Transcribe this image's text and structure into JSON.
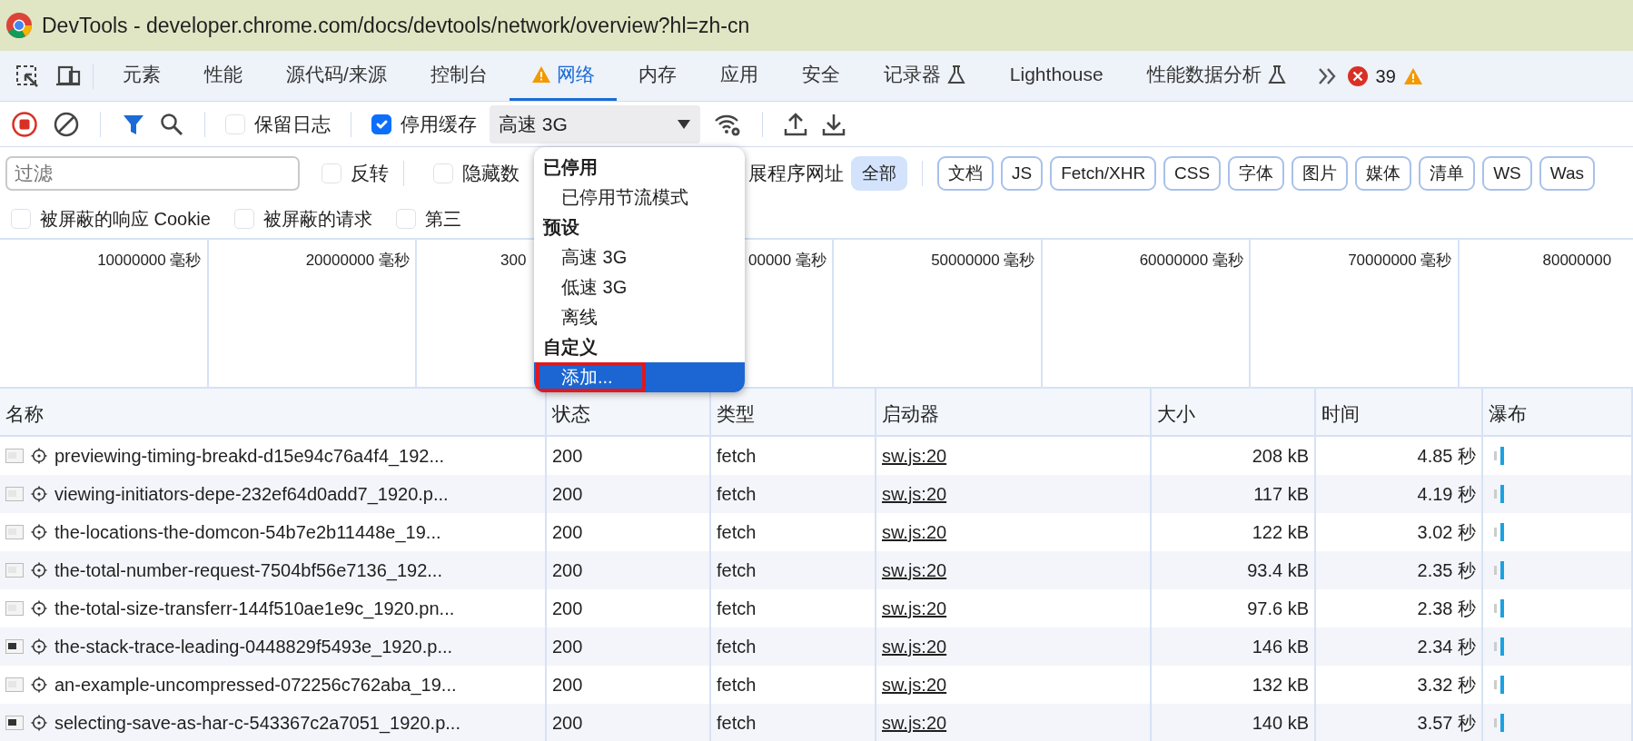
{
  "window": {
    "title": "DevTools - developer.chrome.com/docs/devtools/network/overview?hl=zh-cn"
  },
  "panel_tabs": [
    {
      "label": "元素",
      "selected": false
    },
    {
      "label": "性能",
      "selected": false
    },
    {
      "label": "源代码/来源",
      "selected": false
    },
    {
      "label": "控制台",
      "selected": false
    },
    {
      "label": "网络",
      "selected": true,
      "warning": true
    },
    {
      "label": "内存",
      "selected": false
    },
    {
      "label": "应用",
      "selected": false
    },
    {
      "label": "安全",
      "selected": false
    },
    {
      "label": "记录器",
      "selected": false,
      "experimental": true
    },
    {
      "label": "Lighthouse",
      "selected": false
    },
    {
      "label": "性能数据分析",
      "selected": false,
      "experimental": true
    }
  ],
  "issues": {
    "errors": "39"
  },
  "toolbar": {
    "recording": true,
    "filter_active": true,
    "preserve_log": {
      "label": "保留日志",
      "checked": false
    },
    "disable_cache": {
      "label": "停用缓存",
      "checked": true
    },
    "throttling": {
      "value": "高速 3G"
    }
  },
  "filter_bar": {
    "placeholder": "过滤",
    "options": [
      {
        "label": "反转",
        "checked": false
      },
      {
        "label": "隐藏数",
        "checked": false
      }
    ],
    "hidden_option_tail": "展程序网址",
    "type_filters": [
      {
        "label": "全部",
        "selected": true
      },
      {
        "label": "文档",
        "selected": false
      },
      {
        "label": "JS",
        "selected": false
      },
      {
        "label": "Fetch/XHR",
        "selected": false
      },
      {
        "label": "CSS",
        "selected": false
      },
      {
        "label": "字体",
        "selected": false
      },
      {
        "label": "图片",
        "selected": false
      },
      {
        "label": "媒体",
        "selected": false
      },
      {
        "label": "清单",
        "selected": false
      },
      {
        "label": "WS",
        "selected": false
      },
      {
        "label": "Was",
        "selected": false
      }
    ]
  },
  "blocked_filters": [
    {
      "label": "被屏蔽的响应 Cookie",
      "checked": false
    },
    {
      "label": "被屏蔽的请求",
      "checked": false
    },
    {
      "label": "第三",
      "checked": false
    }
  ],
  "overview": {
    "ticks": [
      {
        "label": "10000000 毫秒",
        "kind": "full"
      },
      {
        "label": "20000000 毫秒",
        "kind": "full"
      },
      {
        "label": "300",
        "kind": "cut"
      },
      {
        "label": "00000 毫秒",
        "kind": "full"
      },
      {
        "label": "50000000 毫秒",
        "kind": "full"
      },
      {
        "label": "60000000 毫秒",
        "kind": "full"
      },
      {
        "label": "70000000 毫秒",
        "kind": "full"
      },
      {
        "label": "80000000",
        "kind": "cut"
      }
    ]
  },
  "throttling_menu": {
    "groups": [
      {
        "heading": "已停用",
        "options": [
          {
            "label": "已停用节流模式",
            "selected": false,
            "outlined": false
          }
        ]
      },
      {
        "heading": "预设",
        "options": [
          {
            "label": "高速 3G",
            "selected": false,
            "outlined": false
          },
          {
            "label": "低速 3G",
            "selected": false,
            "outlined": false
          },
          {
            "label": "离线",
            "selected": false,
            "outlined": false
          }
        ]
      },
      {
        "heading": "自定义",
        "options": [
          {
            "label": "添加...",
            "selected": true,
            "outlined": true
          }
        ]
      }
    ]
  },
  "table": {
    "columns": [
      "名称",
      "状态",
      "类型",
      "启动器",
      "大小",
      "时间",
      "瀑布"
    ],
    "rows": [
      {
        "name": "previewing-timing-breakd-d15e94c76a4f4_192...",
        "status": "200",
        "type": "fetch",
        "initiator": "sw.js:20",
        "size": "208 kB",
        "time": "4.85 秒",
        "dark_thumbnail": false
      },
      {
        "name": "viewing-initiators-depe-232ef64d0add7_1920.p...",
        "status": "200",
        "type": "fetch",
        "initiator": "sw.js:20",
        "size": "117 kB",
        "time": "4.19 秒",
        "dark_thumbnail": false
      },
      {
        "name": "the-locations-the-domcon-54b7e2b11448e_19...",
        "status": "200",
        "type": "fetch",
        "initiator": "sw.js:20",
        "size": "122 kB",
        "time": "3.02 秒",
        "dark_thumbnail": false
      },
      {
        "name": "the-total-number-request-7504bf56e7136_192...",
        "status": "200",
        "type": "fetch",
        "initiator": "sw.js:20",
        "size": "93.4 kB",
        "time": "2.35 秒",
        "dark_thumbnail": false
      },
      {
        "name": "the-total-size-transferr-144f510ae1e9c_1920.pn...",
        "status": "200",
        "type": "fetch",
        "initiator": "sw.js:20",
        "size": "97.6 kB",
        "time": "2.38 秒",
        "dark_thumbnail": false
      },
      {
        "name": "the-stack-trace-leading-0448829f5493e_1920.p...",
        "status": "200",
        "type": "fetch",
        "initiator": "sw.js:20",
        "size": "146 kB",
        "time": "2.34 秒",
        "dark_thumbnail": true
      },
      {
        "name": "an-example-uncompressed-072256c762aba_19...",
        "status": "200",
        "type": "fetch",
        "initiator": "sw.js:20",
        "size": "132 kB",
        "time": "3.32 秒",
        "dark_thumbnail": false
      },
      {
        "name": "selecting-save-as-har-c-543367c2a7051_1920.p...",
        "status": "200",
        "type": "fetch",
        "initiator": "sw.js:20",
        "size": "140 kB",
        "time": "3.57 秒",
        "dark_thumbnail": true
      }
    ]
  }
}
